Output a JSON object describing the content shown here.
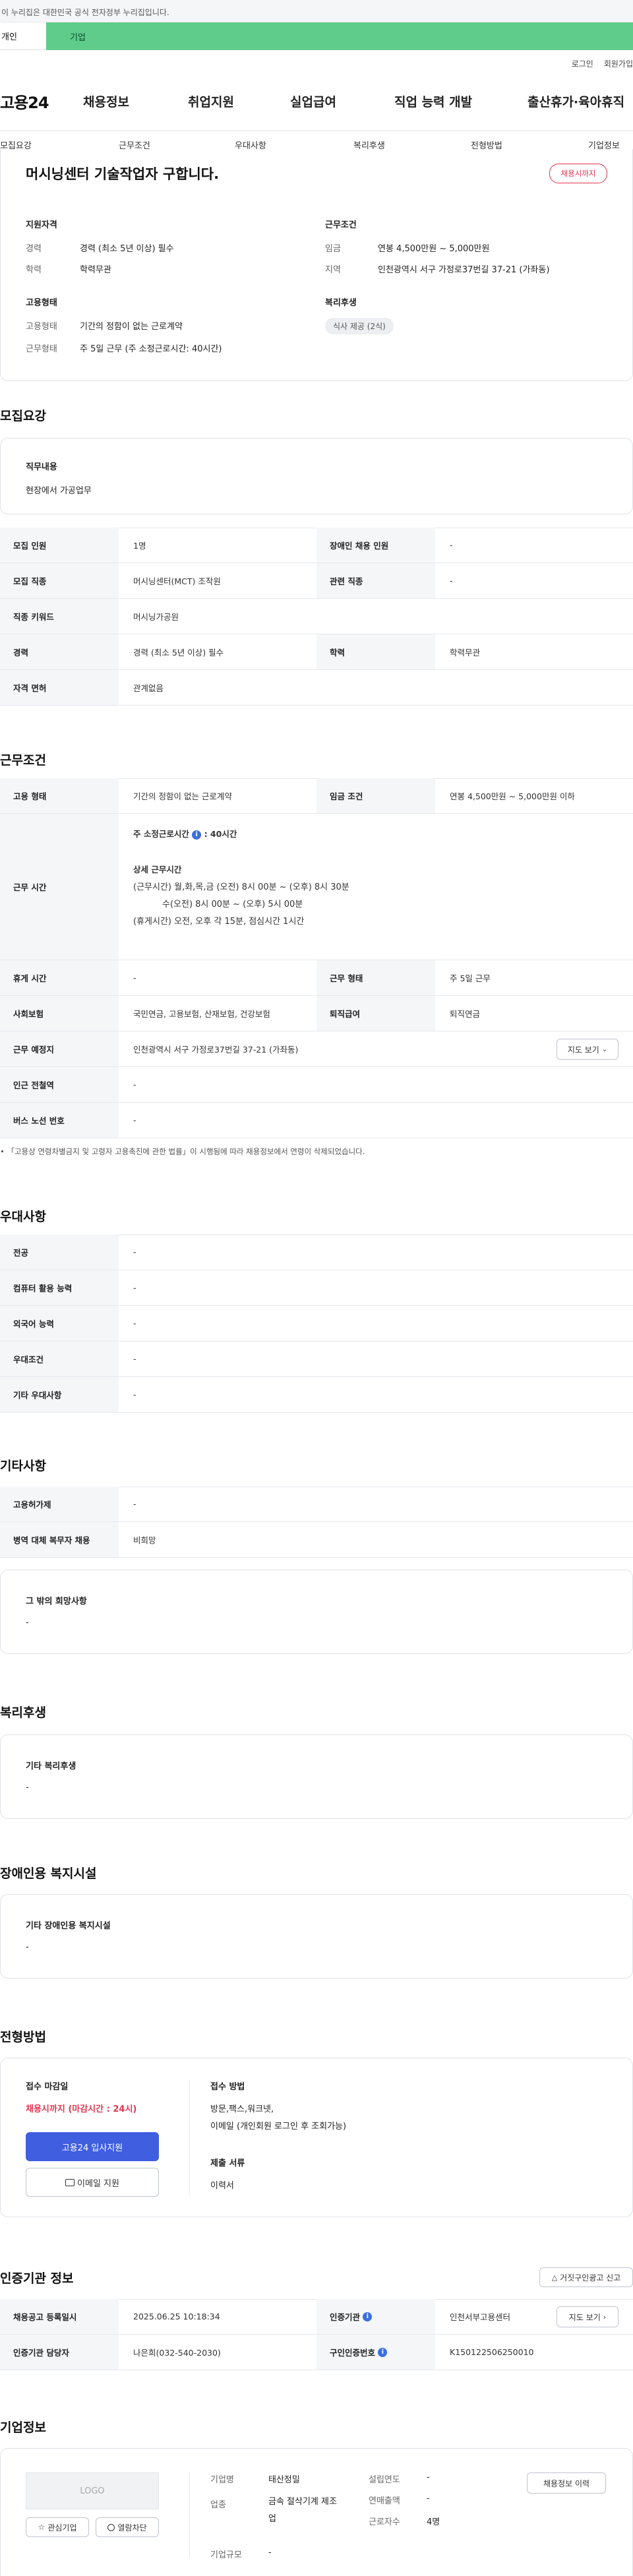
{
  "banner": {
    "text": "이 누리집은 대한민국 공식 전자정부 누리집입니다."
  },
  "strip": {
    "left": "개인",
    "right": "기업"
  },
  "util": {
    "login": "로그인",
    "join": "회원가입"
  },
  "gnb": {
    "logo": "고용24",
    "menu": [
      "채용정보",
      "취업지원",
      "실업급여",
      "직업 능력 개발",
      "출산휴가·육아휴직"
    ]
  },
  "subnav": [
    "모집요강",
    "근무조건",
    "우대사항",
    "복리후생",
    "전형방법",
    "기업정보"
  ],
  "summary": {
    "title": "머시닝센터 기술작업자 구합니다.",
    "badge": "채용시까지",
    "qual_heading": "지원자격",
    "career_label": "경력",
    "career_value": "경력 (최소 5년 이상) 필수",
    "edu_label": "학력",
    "edu_value": "학력무관",
    "emp_heading": "고용형태",
    "emptype_label": "고용형태",
    "emptype_value": "기간의 정함이 없는 근로계약",
    "worktype_label": "근무형태",
    "worktype_value": "주 5일 근무 (주 소정근로시간: 40시간)",
    "cond_heading": "근무조건",
    "wage_label": "임금",
    "wage_value": "연봉 4,500만원 ~ 5,000만원",
    "region_label": "지역",
    "region_value": "인천광역시 서구 가정로37번길 37-21 (가좌동)",
    "welfare_heading": "복리후생",
    "welfare_pill": "식사 제공 (2식)"
  },
  "recruit": {
    "heading": "모집요강",
    "duty_label": "직무내용",
    "duty_value": "현장에서 가공업무",
    "rows": [
      {
        "l1": "모집 인원",
        "v1": "1명",
        "l2": "장애인 채용 인원",
        "v2": "-"
      },
      {
        "l1": "모집 직종",
        "v1": "머시닝센터(MCT) 조작원",
        "l2": "관련 직종",
        "v2": "-"
      },
      {
        "l1": "직종 키워드",
        "v1": "머시닝가공원",
        "l2": "",
        "v2": ""
      },
      {
        "l1": "경력",
        "v1": "경력 (최소 5년 이상) 필수",
        "l2": "학력",
        "v2": "학력무관"
      },
      {
        "l1": "자격 면허",
        "v1": "관계없음",
        "l2": "",
        "v2": ""
      }
    ]
  },
  "work": {
    "heading": "근무조건",
    "emp_label": "고용 형태",
    "emp_value": "기간의 정함이 없는 근로계약",
    "wage_label": "임금 조건",
    "wage_value": "연봉 4,500만원 ~ 5,000만원 이하",
    "hours_label": "근무 시간",
    "hours_weekly": "주 소정근로시간",
    "hours_weekly_val": ": 40시간",
    "hours_detail_title": "상세 근무시간",
    "hours_l1": "(근무시간) 월,화,목,금 (오전) 8시 00분 ~ (오후) 8시 30분",
    "hours_l2": "수(오전) 8시 00분 ~ (오후) 5시 00분",
    "hours_l3": "(휴게시간) 오전, 오후 각 15분, 점심시간 1시간",
    "rows": [
      {
        "l1": "휴게 시간",
        "v1": "-",
        "l2": "근무 형태",
        "v2": "주 5일 근무"
      },
      {
        "l1": "사회보험",
        "v1": "국민연금, 고용보험, 산재보험, 건강보험",
        "l2": "퇴직급여",
        "v2": "퇴직연금"
      }
    ],
    "loc_label": "근무 예정지",
    "loc_value": "인천광역시 서구 가정로37번길 37-21 (가좌동)",
    "map_btn": "지도 보기",
    "station_label": "인근 전철역",
    "station_value": "-",
    "bus_label": "버스 노선 번호",
    "bus_value": "-",
    "note": "「고용상 연령차별금지 및 고령자 고용촉진에 관한 법률」이 시행됨에 따라 채용정보에서 연령이 삭제되었습니다."
  },
  "pref": {
    "heading": "우대사항",
    "rows": [
      {
        "l": "전공",
        "v": "-"
      },
      {
        "l": "컴퓨터 활용 능력",
        "v": "-"
      },
      {
        "l": "외국어 능력",
        "v": "-"
      },
      {
        "l": "우대조건",
        "v": "-"
      },
      {
        "l": "기타 우대사항",
        "v": "-"
      }
    ]
  },
  "other": {
    "heading": "기타사항",
    "rows": [
      {
        "l": "고용허가제",
        "v": "-"
      },
      {
        "l": "병역 대체 복무자 채용",
        "v": "비희망"
      }
    ],
    "hope_label": "그 밖의 희망사항",
    "hope_value": "-"
  },
  "welfare": {
    "heading": "복리후생",
    "label": "기타 복리후생",
    "value": "-"
  },
  "disabled": {
    "heading": "장애인용 복지시설",
    "label": "기타 장애인용 복지시설",
    "value": "-"
  },
  "screen": {
    "heading": "전형방법",
    "deadline_label": "접수 마감일",
    "deadline_value": "채용시까지 (마감시간 : 24시)",
    "apply_btn": "고용24 입사지원",
    "email_btn": "이메일 지원",
    "method_label": "접수 방법",
    "method_l1": "방문,팩스,워크넷,",
    "method_l2": "이메일 (개인회원 로그인 후 조회가능)",
    "docs_label": "제출 서류",
    "docs_value": "이력서"
  },
  "cert": {
    "heading": "인증기관 정보",
    "report_btn": "거짓구인광고 신고",
    "reg_label": "채용공고 등록일시",
    "reg_value": "2025.06.25 10:18:34",
    "org_label": "인증기관",
    "org_value": "인천서부고용센터",
    "map_btn": "지도 보기",
    "mgr_label": "인증기관 담당자",
    "mgr_value": "나은희(032-540-2030)",
    "no_label": "구인인증번호",
    "no_value": "K150122506250010"
  },
  "company": {
    "heading": "기업정보",
    "logo": "LOGO",
    "fav_btn": "관심기업",
    "block_btn": "열람차단",
    "name_label": "기업명",
    "name_value": "태산정밀",
    "industry_label": "업종",
    "industry_value": "금속 절삭기계 제조업",
    "size_label": "기업규모",
    "size_value": "-",
    "year_label": "설립연도",
    "year_value": "-",
    "sales_label": "연매출액",
    "sales_value": "-",
    "emp_label": "근로자수",
    "emp_value": "4명",
    "history_btn": "채용정보 이력"
  }
}
